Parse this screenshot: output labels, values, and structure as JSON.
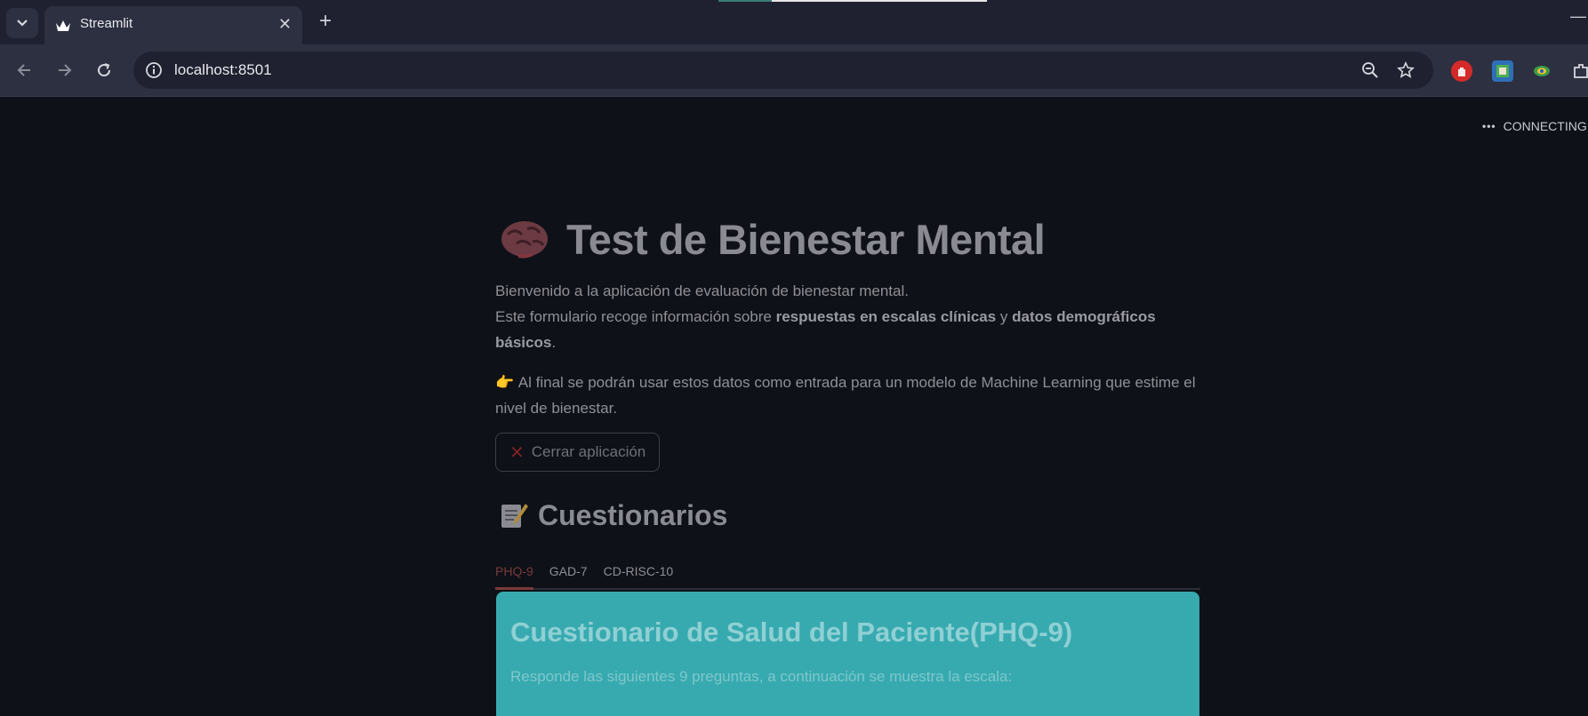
{
  "browser": {
    "tab_title": "Streamlit",
    "url": "localhost:8501"
  },
  "status": {
    "text": "CONNECTING"
  },
  "page": {
    "title": "Test de Bienestar Mental",
    "intro_line1": "Bienvenido a la aplicación de evaluación de bienestar mental.",
    "intro_line2_prefix": "Este formulario recoge información sobre ",
    "intro_line2_bold1": "respuestas en escalas clínicas",
    "intro_line2_mid": " y ",
    "intro_line2_bold2": "datos demográficos básicos",
    "intro_line2_suffix": ".",
    "note_line1": "Al final se podrán usar estos datos como entrada para un modelo de Machine Learning que estime el",
    "note_line2": "nivel de bienestar.",
    "close_button": "Cerrar aplicación",
    "section_title": "Cuestionarios",
    "tabs": [
      "PHQ-9",
      "GAD-7",
      "CD-RISC-10"
    ],
    "active_tab": "PHQ-9",
    "card_title": "Cuestionario de Salud del Paciente(PHQ-9)",
    "card_text": "Responde las siguientes 9 preguntas, a continuación se muestra la escala:"
  },
  "colors": {
    "background": "#0e1117",
    "card": "#37aab0",
    "active_tab": "#7a3a3a"
  }
}
